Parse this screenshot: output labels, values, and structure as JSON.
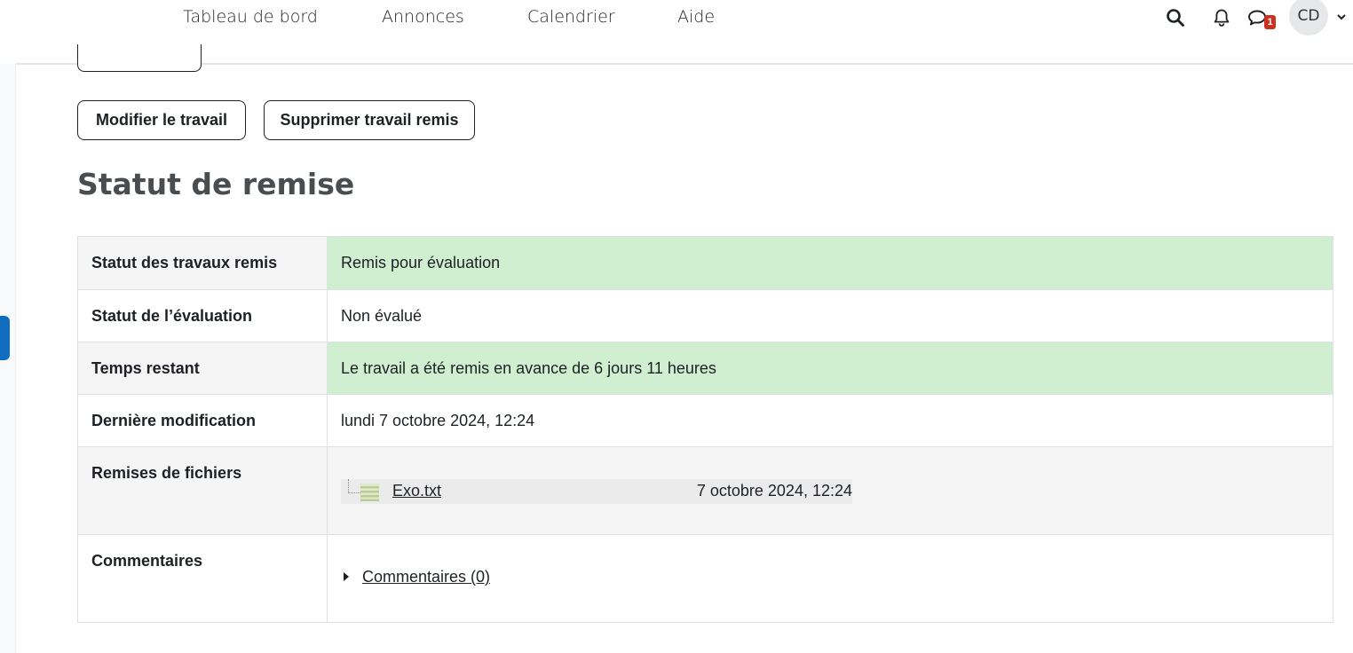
{
  "nav": {
    "links": [
      "Tableau de bord",
      "Annonces",
      "Calendrier",
      "Aide"
    ],
    "message_badge": "1",
    "avatar_initials": "CD"
  },
  "actions": {
    "edit_label": "Modifier le travail",
    "delete_label": "Supprimer travail remis"
  },
  "section": {
    "title": "Statut de remise"
  },
  "status_table": {
    "rows": [
      {
        "label": "Statut des travaux remis",
        "value": "Remis pour évaluation"
      },
      {
        "label": "Statut de l’évaluation",
        "value": "Non évalué"
      },
      {
        "label": "Temps restant",
        "value": "Le travail a été remis en avance de 6 jours 11 heures"
      },
      {
        "label": "Dernière modification",
        "value": "lundi 7 octobre 2024, 12:24"
      },
      {
        "label": "Remises de fichiers",
        "file_name": "Exo.txt",
        "file_date": "7 octobre 2024, 12:24"
      },
      {
        "label": "Commentaires",
        "comments_link": "Commentaires (0)"
      }
    ]
  },
  "colors": {
    "success_bg": "#cfefd0",
    "primary": "#0f6cbf",
    "badge": "#ca3120"
  },
  "icons": [
    "search-icon",
    "bell-icon",
    "chat-icon",
    "chevron-down-icon",
    "text-file-icon",
    "caret-right-icon"
  ]
}
